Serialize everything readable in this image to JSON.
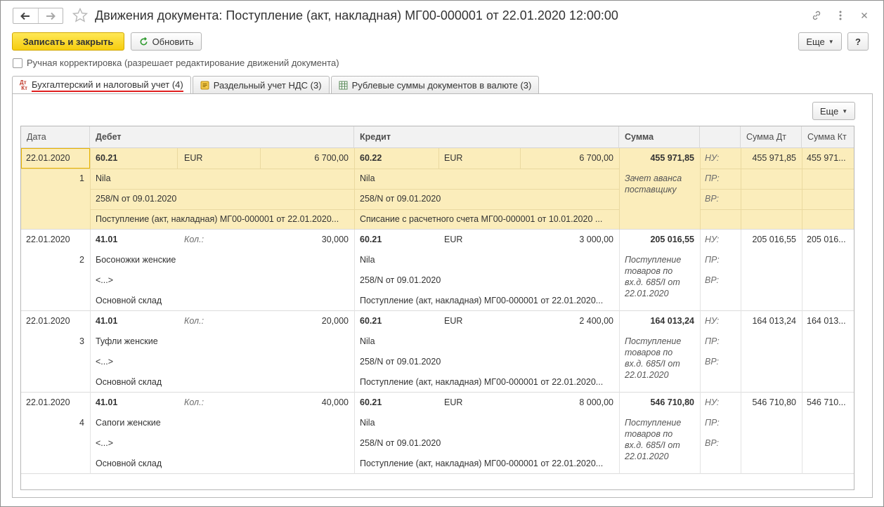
{
  "window": {
    "title": "Движения документа: Поступление (акт, накладная) МГ00-000001 от 22.01.2020 12:00:00"
  },
  "toolbar": {
    "save_close": "Записать и закрыть",
    "refresh": "Обновить",
    "more": "Еще",
    "help": "?"
  },
  "manual_edit": {
    "label": "Ручная корректировка (разрешает редактирование движений документа)",
    "checked": false
  },
  "tabs": [
    {
      "label": "Бухгалтерский и налоговый учет (4)",
      "active": true
    },
    {
      "label": "Раздельный учет НДС (3)",
      "active": false
    },
    {
      "label": "Рублевые суммы документов в валюте (3)",
      "active": false
    }
  ],
  "table": {
    "more": "Еще",
    "headers": {
      "date": "Дата",
      "debit": "Дебет",
      "credit": "Кредит",
      "sum": "Сумма",
      "sum_dt": "Сумма Дт",
      "sum_kt": "Сумма Кт"
    },
    "tax_labels": {
      "nu": "НУ:",
      "pr": "ПР:",
      "vr": "ВР:"
    },
    "rows": [
      {
        "date": "22.01.2020",
        "num": "1",
        "dt_account": "60.21",
        "dt_qty_label": "EUR",
        "dt_qty": "6 700,00",
        "dt_sub1": "Nila",
        "dt_sub2": "258/N от 09.01.2020",
        "dt_sub3": "Поступление (акт, накладная) МГ00-000001 от 22.01.2020...",
        "kt_account": "60.22",
        "kt_currency": "EUR",
        "kt_amount": "6 700,00",
        "kt_sub1": "Nila",
        "kt_sub2": "258/N от 09.01.2020",
        "kt_sub3": "Списание с расчетного счета МГ00-000001 от 10.01.2020 ...",
        "sum": "455 971,85",
        "comment": "Зачет аванса поставщику",
        "sum_dt": "455 971,85",
        "sum_kt": "455 971..."
      },
      {
        "date": "22.01.2020",
        "num": "2",
        "dt_account": "41.01",
        "dt_qty_label": "Кол.:",
        "dt_qty": "30,000",
        "dt_sub1": "Босоножки женские",
        "dt_sub2": "<...>",
        "dt_sub3": "Основной склад",
        "kt_account": "60.21",
        "kt_currency": "EUR",
        "kt_amount": "3 000,00",
        "kt_sub1": "Nila",
        "kt_sub2": "258/N от 09.01.2020",
        "kt_sub3": "Поступление (акт, накладная) МГ00-000001 от 22.01.2020...",
        "sum": "205 016,55",
        "comment": "Поступление товаров по вх.д. 685/I от 22.01.2020",
        "sum_dt": "205 016,55",
        "sum_kt": "205 016..."
      },
      {
        "date": "22.01.2020",
        "num": "3",
        "dt_account": "41.01",
        "dt_qty_label": "Кол.:",
        "dt_qty": "20,000",
        "dt_sub1": "Туфли женские",
        "dt_sub2": "<...>",
        "dt_sub3": "Основной склад",
        "kt_account": "60.21",
        "kt_currency": "EUR",
        "kt_amount": "2 400,00",
        "kt_sub1": "Nila",
        "kt_sub2": "258/N от 09.01.2020",
        "kt_sub3": "Поступление (акт, накладная) МГ00-000001 от 22.01.2020...",
        "sum": "164 013,24",
        "comment": "Поступление товаров по вх.д. 685/I от 22.01.2020",
        "sum_dt": "164 013,24",
        "sum_kt": "164 013..."
      },
      {
        "date": "22.01.2020",
        "num": "4",
        "dt_account": "41.01",
        "dt_qty_label": "Кол.:",
        "dt_qty": "40,000",
        "dt_sub1": "Сапоги женские",
        "dt_sub2": "<...>",
        "dt_sub3": "Основной склад",
        "kt_account": "60.21",
        "kt_currency": "EUR",
        "kt_amount": "8 000,00",
        "kt_sub1": "Nila",
        "kt_sub2": "258/N от 09.01.2020",
        "kt_sub3": "Поступление (акт, накладная) МГ00-000001 от 22.01.2020...",
        "sum": "546 710,80",
        "comment": "Поступление товаров по вх.д. 685/I от 22.01.2020",
        "sum_dt": "546 710,80",
        "sum_kt": "546 710..."
      }
    ]
  },
  "colors": {
    "primary_button": "#f6cd0e",
    "selected_row": "#fbedbb",
    "active_tab_underline": "#e02020"
  }
}
